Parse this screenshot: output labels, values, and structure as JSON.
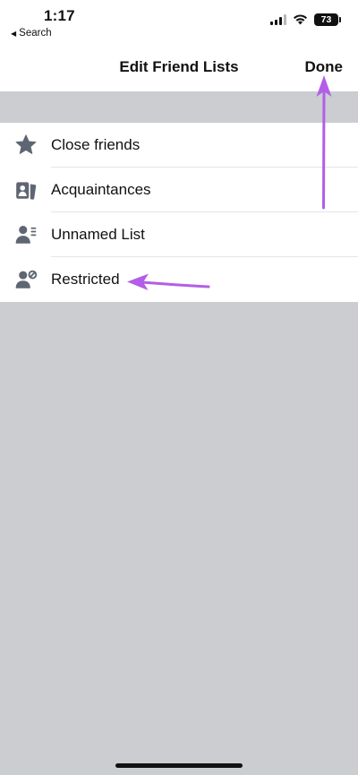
{
  "status_bar": {
    "time": "1:17",
    "back_label": "Search",
    "back_arrow": "◀",
    "battery": "73"
  },
  "nav": {
    "title": "Edit Friend Lists",
    "done_label": "Done"
  },
  "list": {
    "items": [
      {
        "label": "Close friends",
        "icon": "star-icon"
      },
      {
        "label": "Acquaintances",
        "icon": "acquaintances-icon"
      },
      {
        "label": "Unnamed List",
        "icon": "person-list-icon"
      },
      {
        "label": "Restricted",
        "icon": "person-restricted-icon"
      }
    ]
  },
  "colors": {
    "icon": "#5f6673",
    "background": "#cbcdd1",
    "annotation_arrow": "#b35ee8"
  }
}
